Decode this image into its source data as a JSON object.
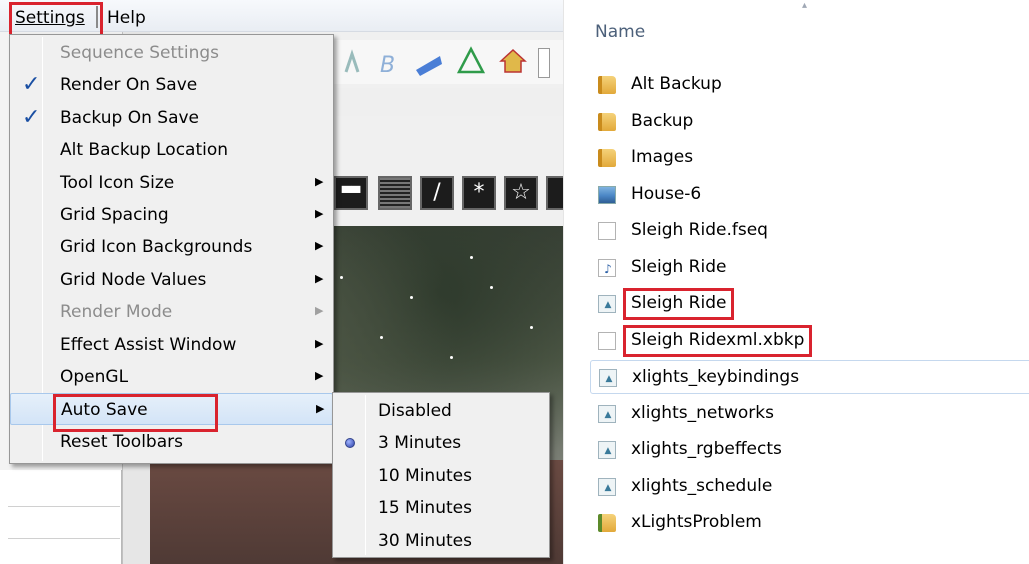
{
  "menubar": {
    "settings_label": "Settings",
    "help_label": "Help"
  },
  "settings_menu": {
    "items": [
      {
        "label": "Sequence Settings",
        "enabled": false,
        "checked": false,
        "submenu": false
      },
      {
        "label": "Render On Save",
        "enabled": true,
        "checked": true,
        "submenu": false
      },
      {
        "label": "Backup On Save",
        "enabled": true,
        "checked": true,
        "submenu": false
      },
      {
        "label": "Alt Backup Location",
        "enabled": true,
        "checked": false,
        "submenu": false
      },
      {
        "label": "Tool Icon Size",
        "enabled": true,
        "checked": false,
        "submenu": true
      },
      {
        "label": "Grid Spacing",
        "enabled": true,
        "checked": false,
        "submenu": true
      },
      {
        "label": "Grid Icon Backgrounds",
        "enabled": true,
        "checked": false,
        "submenu": true
      },
      {
        "label": "Grid Node Values",
        "enabled": true,
        "checked": false,
        "submenu": true
      },
      {
        "label": "Render Mode",
        "enabled": false,
        "checked": false,
        "submenu": true
      },
      {
        "label": "Effect Assist Window",
        "enabled": true,
        "checked": false,
        "submenu": true
      },
      {
        "label": "OpenGL",
        "enabled": true,
        "checked": false,
        "submenu": true
      },
      {
        "label": "Auto Save",
        "enabled": true,
        "checked": false,
        "submenu": true,
        "active": true
      },
      {
        "label": "Reset Toolbars",
        "enabled": true,
        "checked": false,
        "submenu": false
      }
    ]
  },
  "autosave_submenu": {
    "items": [
      {
        "label": "Disabled",
        "selected": false
      },
      {
        "label": "3 Minutes",
        "selected": true
      },
      {
        "label": "10 Minutes",
        "selected": false
      },
      {
        "label": "15 Minutes",
        "selected": false
      },
      {
        "label": "30 Minutes",
        "selected": false
      }
    ]
  },
  "explorer": {
    "column_header": "Name",
    "files": [
      {
        "name": "Alt Backup",
        "icon": "folder-icon"
      },
      {
        "name": "Backup",
        "icon": "folder-icon"
      },
      {
        "name": "Images",
        "icon": "folder-icon"
      },
      {
        "name": "House-6",
        "icon": "image-file-icon"
      },
      {
        "name": "Sleigh Ride.fseq",
        "icon": "blank-file-icon"
      },
      {
        "name": "Sleigh Ride",
        "icon": "mp3-file-icon"
      },
      {
        "name": "Sleigh Ride",
        "icon": "xml-file-icon",
        "highlighted": true
      },
      {
        "name": "Sleigh Ridexml.xbkp",
        "icon": "blank-file-icon",
        "highlighted": true
      },
      {
        "name": "xlights_keybindings",
        "icon": "xml-file-icon",
        "selected": true
      },
      {
        "name": "xlights_networks",
        "icon": "xml-file-icon"
      },
      {
        "name": "xlights_rgbeffects",
        "icon": "xml-file-icon"
      },
      {
        "name": "xlights_schedule",
        "icon": "xml-file-icon"
      },
      {
        "name": "xLightsProblem",
        "icon": "zip-folder-icon"
      }
    ]
  },
  "colors": {
    "highlight_red": "#d9232e",
    "check_blue": "#1a4fa3",
    "header_text": "#4c607a"
  }
}
